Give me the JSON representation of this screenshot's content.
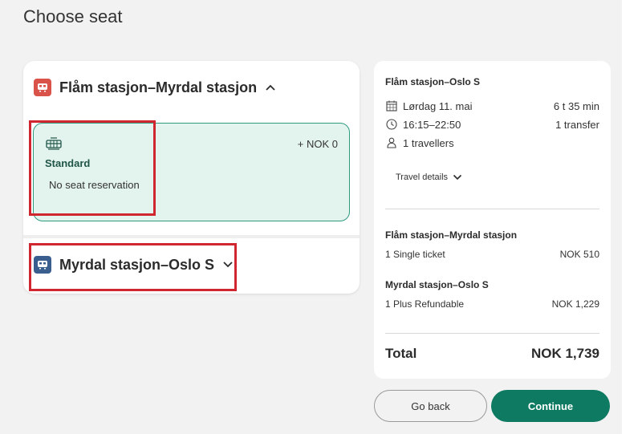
{
  "page": {
    "title": "Choose seat"
  },
  "legs": [
    {
      "title": "Flåm stasjon–Myrdal stasjon",
      "badge_color": "#d9534a",
      "expanded": true,
      "seat_option": {
        "icon": "train-seat-icon",
        "name": "Standard",
        "description": "No seat reservation",
        "price": "+ NOK 0"
      }
    },
    {
      "title": "Myrdal stasjon–Oslo S",
      "badge_color": "#3a5f8f",
      "expanded": false
    }
  ],
  "summary": {
    "route": "Flåm stasjon–Oslo S",
    "date": "Lørdag 11. mai",
    "duration": "6 t 35 min",
    "time": "16:15–22:50",
    "transfers": "1 transfer",
    "travellers": "1 travellers",
    "travel_details": "Travel details",
    "legs": [
      {
        "title": "Flåm stasjon–Myrdal stasjon",
        "ticket": "1 Single ticket",
        "price": "NOK  510"
      },
      {
        "title": "Myrdal stasjon–Oslo S",
        "ticket": "1 Plus Refundable",
        "price": "NOK  1,229"
      }
    ],
    "total_label": "Total",
    "total_amount": "NOK  1,739"
  },
  "buttons": {
    "back": "Go back",
    "continue": "Continue"
  },
  "colors": {
    "accent": "#0e7a62",
    "selected_bg": "#e3f3ee",
    "highlight": "#d0262f"
  }
}
